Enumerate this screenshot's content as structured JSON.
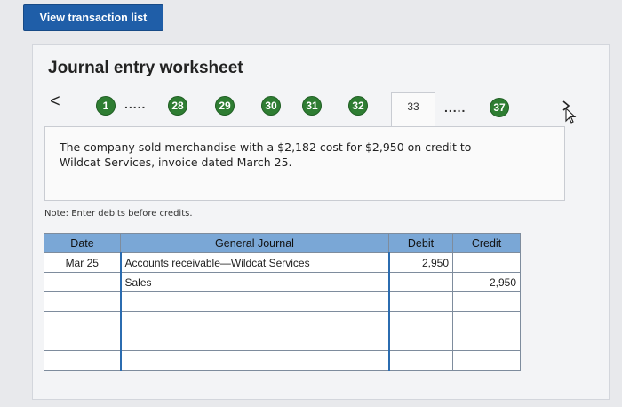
{
  "top_button": "View transaction list",
  "worksheet": {
    "title": "Journal entry worksheet",
    "pager": {
      "prev": "<",
      "steps": [
        "1",
        "28",
        "29",
        "30",
        "31",
        "32",
        "33",
        "37"
      ],
      "active": "33",
      "ellipsis": "....."
    },
    "description_line1": "The company sold merchandise with a $2,182 cost for $2,950 on credit to",
    "description_line2": "Wildcat Services, invoice dated March 25.",
    "note": "Note: Enter debits before credits."
  },
  "journal": {
    "headers": {
      "date": "Date",
      "general_journal": "General Journal",
      "debit": "Debit",
      "credit": "Credit"
    },
    "rows": [
      {
        "date": "Mar 25",
        "account": "Accounts receivable—Wildcat Services",
        "debit": "2,950",
        "credit": ""
      },
      {
        "date": "",
        "account": "Sales",
        "debit": "",
        "credit": "2,950"
      },
      {
        "date": "",
        "account": "",
        "debit": "",
        "credit": ""
      },
      {
        "date": "",
        "account": "",
        "debit": "",
        "credit": ""
      },
      {
        "date": "",
        "account": "",
        "debit": "",
        "credit": ""
      },
      {
        "date": "",
        "account": "",
        "debit": "",
        "credit": ""
      }
    ]
  },
  "colors": {
    "step_circle": "#2e7d32",
    "button": "#1f5ea8",
    "header": "#7aa7d6"
  }
}
